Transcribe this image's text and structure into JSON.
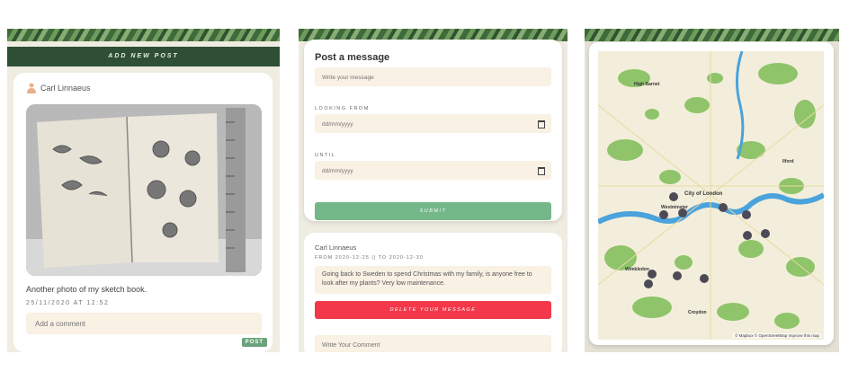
{
  "feed": {
    "add_post_label": "ADD NEW POST",
    "post": {
      "author": "Carl Linnaeus",
      "caption": "Another photo of my sketch book.",
      "date": "25/11/2020 AT 12:52",
      "comment_placeholder": "Add a comment",
      "post_button": "POST"
    }
  },
  "message_form": {
    "title": "Post a message",
    "message_placeholder": "Write your message",
    "looking_from_label": "LOOKING FROM",
    "until_label": "UNTIL",
    "date_placeholder": "dd/mm/yyyy",
    "submit_label": "SUBMIT"
  },
  "message": {
    "author": "Carl Linnaeus",
    "range": "FROM 2020-12-25 || TO 2020-12-30",
    "text": "Going back to Sweden to spend Christmas with my family, is anyone free to look after my plants? Very low maintenance.",
    "delete_label": "DELETE YOUR MESSAGE",
    "reply_placeholder": "Write Your Comment"
  },
  "map": {
    "labels": {
      "high_barnet": "High Barnet",
      "city_of_london": "City of London",
      "westminster": "Westminster",
      "wimbledon": "Wimbledon",
      "croydon": "Croydon",
      "ilford": "Ilford"
    },
    "attribution": "© Mapbox © OpenStreetMap Improve this map",
    "colors": {
      "park": "#8fc46a",
      "water": "#4aa3dc",
      "land": "#f3eedb"
    },
    "marker_icon": "plant-pot-marker"
  }
}
